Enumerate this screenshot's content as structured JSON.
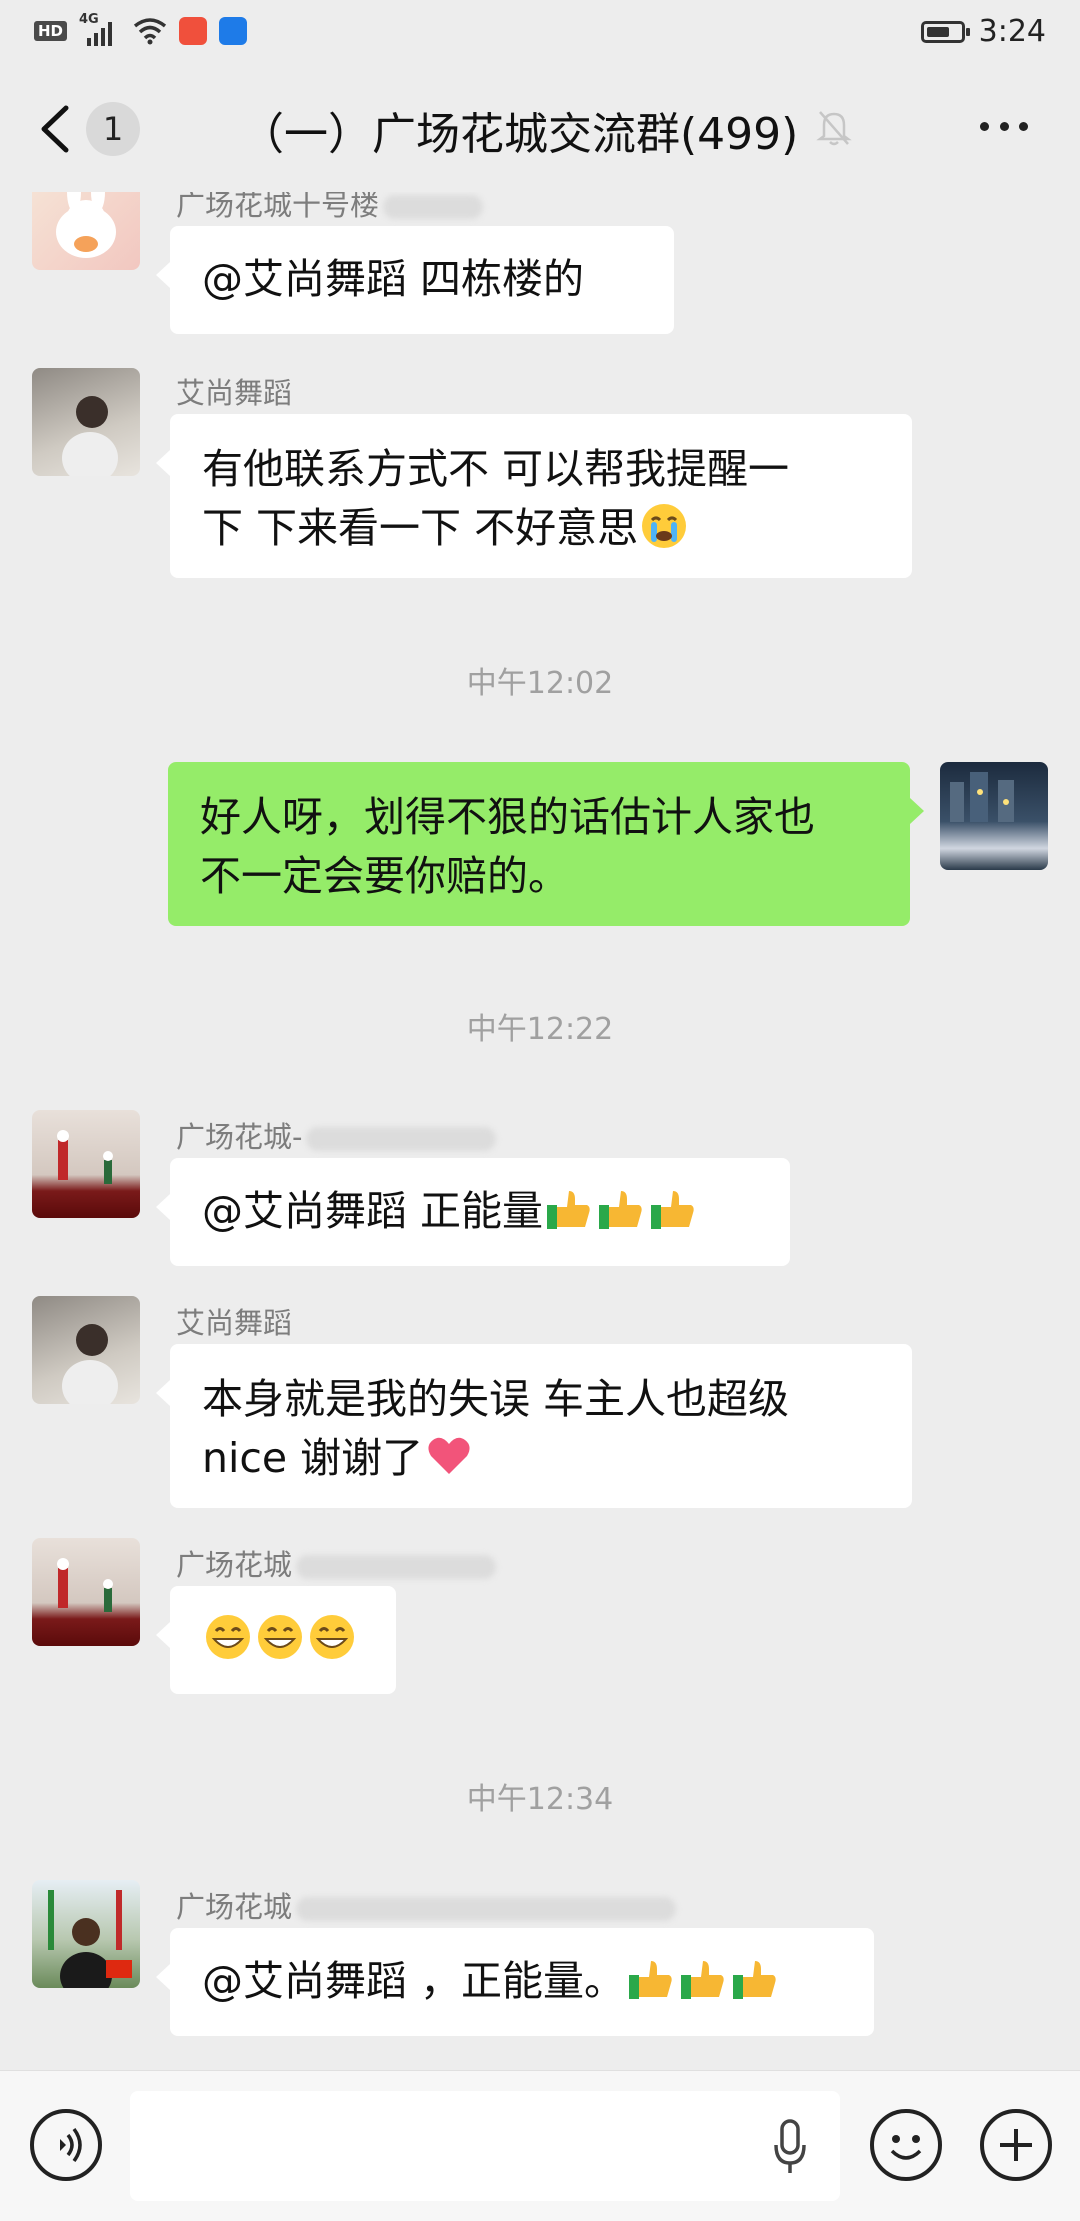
{
  "status_bar": {
    "hd": "HD",
    "network": "4G",
    "time": "3:24"
  },
  "header": {
    "unread_count": "1",
    "title": "（一）广场花城交流群(499)"
  },
  "timestamps": [
    "中午12:02",
    "中午12:22",
    "中午12:34"
  ],
  "messages": [
    {
      "sender": "广场花城十号楼",
      "text": "@艾尚舞蹈  四栋楼的"
    },
    {
      "sender": "艾尚舞蹈",
      "text_line1": "有他联系方式不 可以帮我提醒一",
      "text_line2": "下 下来看一下 不好意思"
    },
    {
      "text_line1": "好人呀，划得不狠的话估计人家也",
      "text_line2": "不一定会要你赔的。"
    },
    {
      "sender": "广场花城-",
      "text": "@艾尚舞蹈  正能量"
    },
    {
      "sender": "艾尚舞蹈",
      "text_line1": "本身就是我的失误  车主人也超级",
      "text_line2": "nice  谢谢了"
    },
    {
      "sender": "广场花城"
    },
    {
      "sender": "广场花城",
      "text": "@艾尚舞蹈 ，正能量。"
    }
  ],
  "icons": {
    "back": "chevron-left-icon",
    "mute": "bell-off-icon",
    "more": "more-icon",
    "voice": "voice-icon",
    "mic": "mic-icon",
    "emoji": "emoji-icon",
    "plus": "plus-icon"
  },
  "colors": {
    "background": "#ededed",
    "self_bubble": "#95ec69",
    "other_bubble": "#ffffff"
  }
}
